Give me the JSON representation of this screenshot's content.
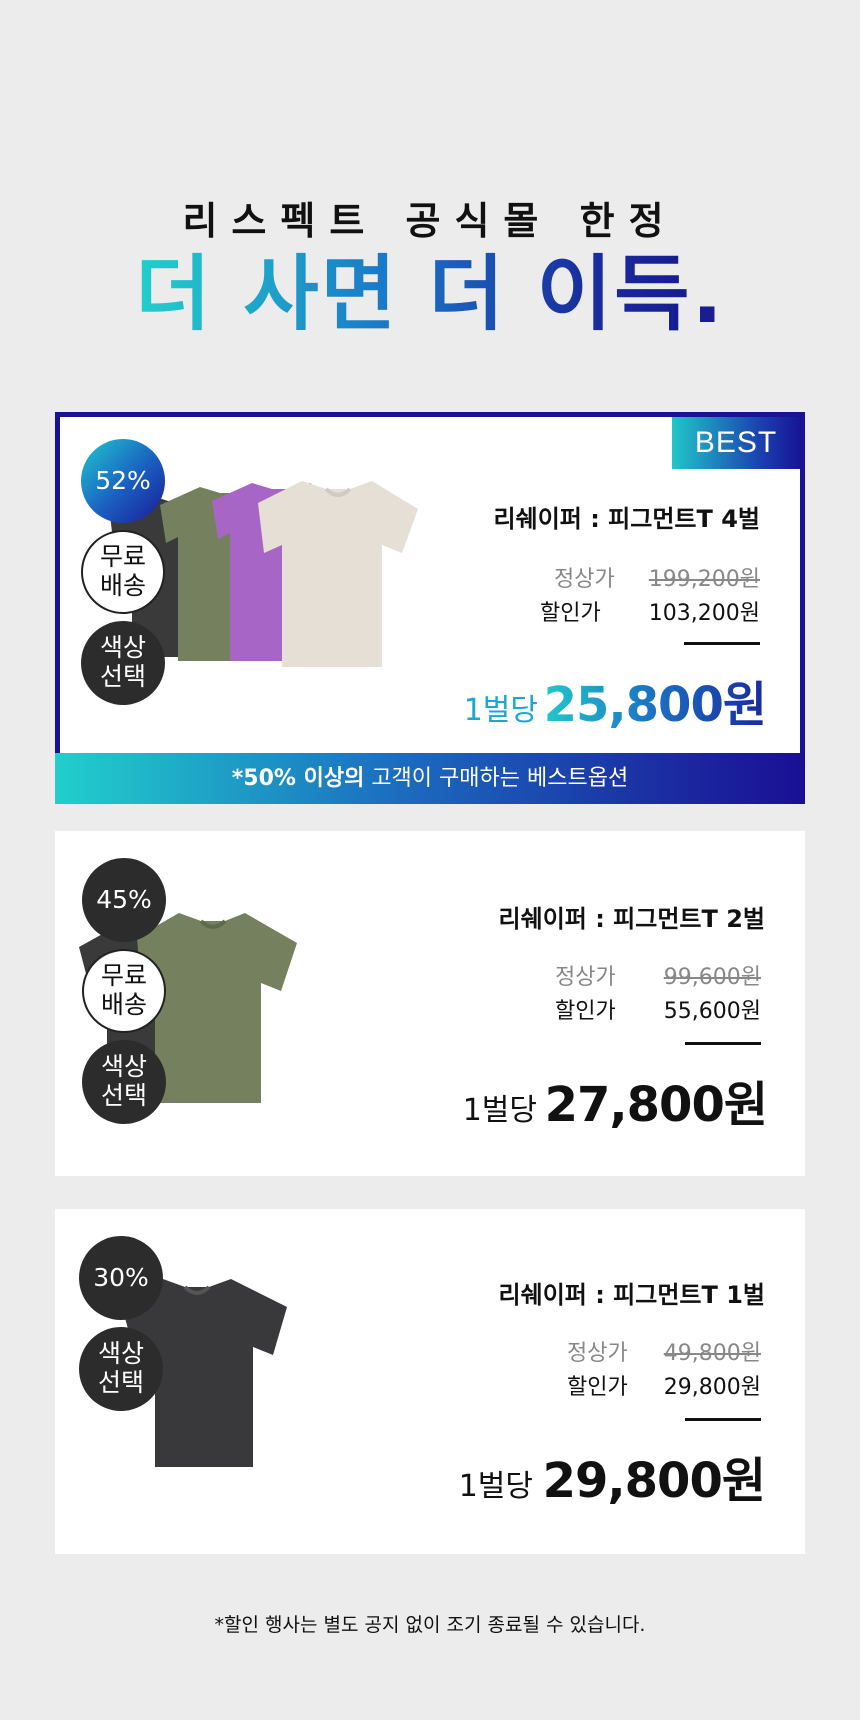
{
  "header": {
    "subtitle": "리스펙트 공식몰 한정",
    "headline": "더 사면 더 이득",
    "headline_dot": "."
  },
  "products": [
    {
      "best_tag": "BEST",
      "discount": "52%",
      "badges": [
        "무료\n배송",
        "색상\n선택"
      ],
      "title": "리쉐이퍼 : 피그먼트T 4벌",
      "original_label": "정상가",
      "original_price": "199,200원",
      "sale_label": "할인가",
      "sale_price": "103,200원",
      "per_label": "1벌당",
      "per_price": "25,800원",
      "footer_bold": "*50% 이상의",
      "footer_rest": " 고객이 구매하는 베스트옵션"
    },
    {
      "discount": "45%",
      "badge_free": "무료\n배송",
      "badge_color": "색상\n선택",
      "title": "리쉐이퍼 : 피그먼트T 2벌",
      "original_label": "정상가",
      "original_price": "99,600원",
      "sale_label": "할인가",
      "sale_price": "55,600원",
      "per_label": "1벌당",
      "per_price": "27,800원"
    },
    {
      "discount": "30%",
      "badge_color": "색상\n선택",
      "title": "리쉐이퍼 : 피그먼트T 1벌",
      "original_label": "정상가",
      "original_price": "49,800원",
      "sale_label": "할인가",
      "sale_price": "29,800원",
      "per_label": "1벌당",
      "per_price": "29,800원"
    }
  ],
  "footnote": "*할인 행사는 별도 공지 없이 조기 종료될 수 있습니다.",
  "colors": {
    "navy": "#1a1296",
    "teal": "#21cfcc",
    "dark_badge": "#2c2c2c",
    "background": "#ececec"
  }
}
